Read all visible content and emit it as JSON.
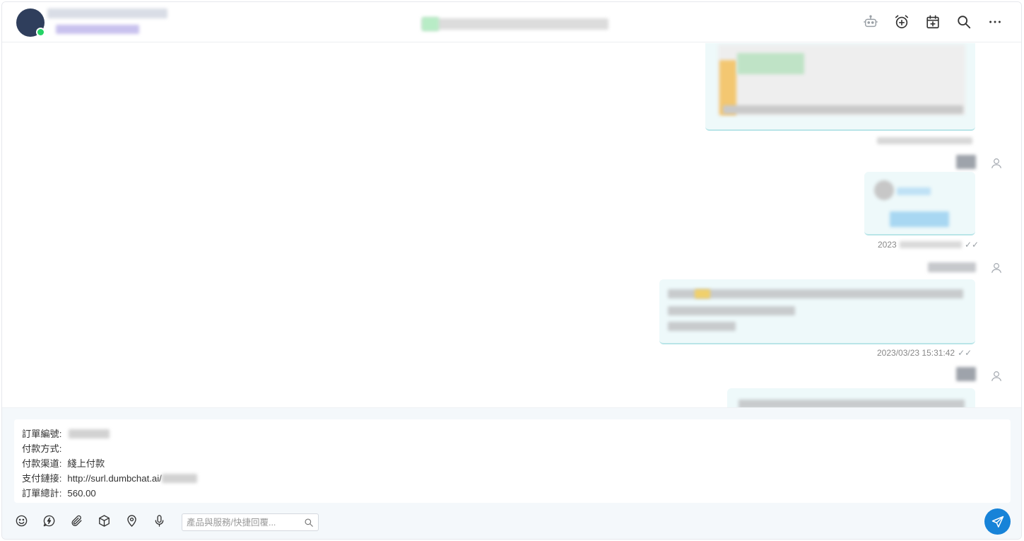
{
  "header": {
    "icons": [
      "robot-icon",
      "alarm-add-icon",
      "calendar-add-icon",
      "search-icon",
      "more-icon"
    ]
  },
  "messages": {
    "timestamp_3": "2023/03/23 15:31:42",
    "timestamp_partial": "2023"
  },
  "composer": {
    "lines": [
      {
        "label": "訂單編號:",
        "value": ""
      },
      {
        "label": "付款方式:",
        "value": ""
      },
      {
        "label": "付款渠道:",
        "value": "綫上付款"
      },
      {
        "label": "支付鏈接:",
        "value": "http://surl.dumbchat.ai/"
      },
      {
        "label": "訂單總計:",
        "value": "560.00"
      }
    ],
    "search_placeholder": "產品與服務/快捷回覆...",
    "toolbar_icons": [
      "emoji-icon",
      "quick-reply-icon",
      "attachment-icon",
      "product-box-icon",
      "location-icon",
      "microphone-icon"
    ]
  },
  "colors": {
    "accent": "#1783d8",
    "bubble": "#eef9fa",
    "avatar": "#2f3e5c",
    "whatsapp": "#25d366"
  }
}
